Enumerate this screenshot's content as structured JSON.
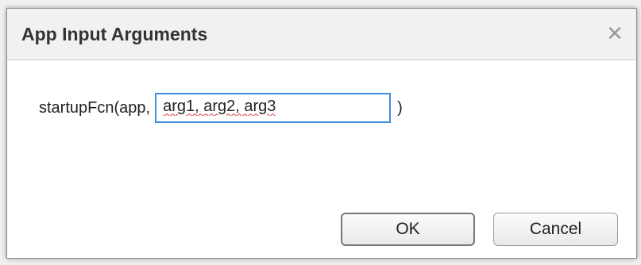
{
  "dialog": {
    "title": "App Input Arguments",
    "close_icon": "close-icon",
    "close_glyph": "✕"
  },
  "signature": {
    "prefix": "startupFcn(app,",
    "input_value": "arg1, arg2, arg3",
    "suffix": ")"
  },
  "buttons": {
    "ok_label": "OK",
    "cancel_label": "Cancel"
  },
  "colors": {
    "input_focus_border": "#3d8ee0",
    "spellcheck_underline": "#d83b3b"
  }
}
